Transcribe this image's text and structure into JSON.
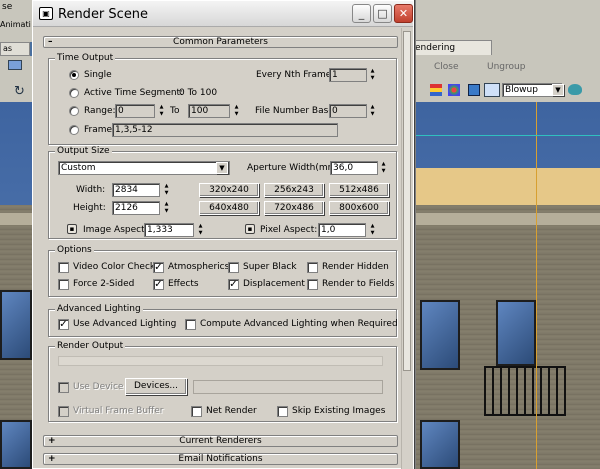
{
  "background": {
    "menu_fragment": "se",
    "toolbar_fragment": "Animati",
    "tab_left": "as",
    "tab_right": "endering",
    "close_label": "Close",
    "ungroup_label": "Ungroup",
    "blowup_value": "Blowup"
  },
  "dialog": {
    "title": "Render Scene",
    "icon_glyph": "▣",
    "minimize": "_",
    "maximize": "□",
    "close": "✕"
  },
  "common": {
    "rollout_title": "Common Parameters",
    "time_output": {
      "title": "Time Output",
      "single": "Single",
      "every_nth_label": "Every Nth Frame:",
      "every_nth_value": "1",
      "active_segment": "Active Time Segment:",
      "active_segment_value": "0 To 100",
      "range_label": "Range:",
      "range_from": "0",
      "to_label": "To",
      "range_to": "100",
      "file_number_base_label": "File Number Base:",
      "file_number_base_value": "0",
      "frames_label": "Frames",
      "frames_value": "1,3,5-12"
    },
    "output_size": {
      "title": "Output Size",
      "preset": "Custom",
      "aperture_label": "Aperture Width(mm):",
      "aperture_value": "36,0",
      "width_label": "Width:",
      "width_value": "2834",
      "height_label": "Height:",
      "height_value": "2126",
      "presets": [
        "320x240",
        "256x243",
        "512x486",
        "640x480",
        "720x486",
        "800x600"
      ],
      "image_aspect_label": "Image Aspect:",
      "image_aspect_value": "1,333",
      "pixel_aspect_label": "Pixel Aspect:",
      "pixel_aspect_value": "1,0"
    },
    "options": {
      "title": "Options",
      "video_color_check": "Video Color Check",
      "atmospherics": "Atmospherics",
      "super_black": "Super Black",
      "render_hidden": "Render Hidden",
      "force_2_sided": "Force 2-Sided",
      "effects": "Effects",
      "displacement": "Displacement",
      "render_to_fields": "Render to Fields"
    },
    "advanced_lighting": {
      "title": "Advanced Lighting",
      "use": "Use Advanced Lighting",
      "compute": "Compute Advanced Lighting when Required"
    },
    "render_output": {
      "title": "Render Output",
      "use_device": "Use Device",
      "devices_button": "Devices...",
      "virtual_frame_buffer": "Virtual Frame Buffer",
      "net_render": "Net Render",
      "skip_existing": "Skip Existing Images"
    }
  },
  "rollouts": {
    "current_renderers": "Current Renderers",
    "email_notifications": "Email Notifications"
  }
}
